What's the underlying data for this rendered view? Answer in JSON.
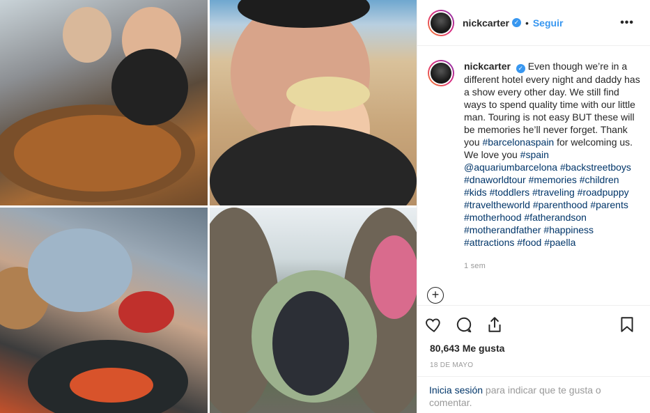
{
  "post": {
    "username": "nickcarter",
    "verified_symbol": "✓",
    "separator": "•",
    "follow_label": "Seguir",
    "more_label": "•••"
  },
  "caption": {
    "username": "nickcarter",
    "text": "Even though we’re in a different hotel every night and daddy has a show every other day. We still find ways to spend quality time with our little man. Touring is not easy BUT these will be memories he’ll never forget. Thank you ",
    "tag1": "#barcelonaspain",
    "text2": " for welcoming us. We love you ",
    "tags_rest": [
      "#spain",
      "@aquariumbarcelona",
      "#backstreetboys",
      "#dnaworldtour",
      "#memories",
      "#children",
      "#kids",
      "#toddlers",
      "#traveling",
      "#roadpuppy",
      "#traveltheworld",
      "#parenthood",
      "#parents",
      "#motherhood",
      "#fatherandson",
      "#motherandfather",
      "#happiness",
      "#attractions",
      "#food",
      "#paella"
    ],
    "time_ago": "1 sem"
  },
  "actions": {
    "like_icon": "heart-icon",
    "comment_icon": "comment-icon",
    "share_icon": "share-icon",
    "save_icon": "bookmark-icon",
    "likes_count": "80,643",
    "likes_label": "Me gusta",
    "date": "18 DE MAYO",
    "add_comment_symbol": "+"
  },
  "login": {
    "link_label": "Inicia sesión",
    "text": " para indicar que te gusta o comentar."
  },
  "colors": {
    "link": "#3897f0",
    "hashtag": "#003569",
    "muted": "#999999"
  }
}
